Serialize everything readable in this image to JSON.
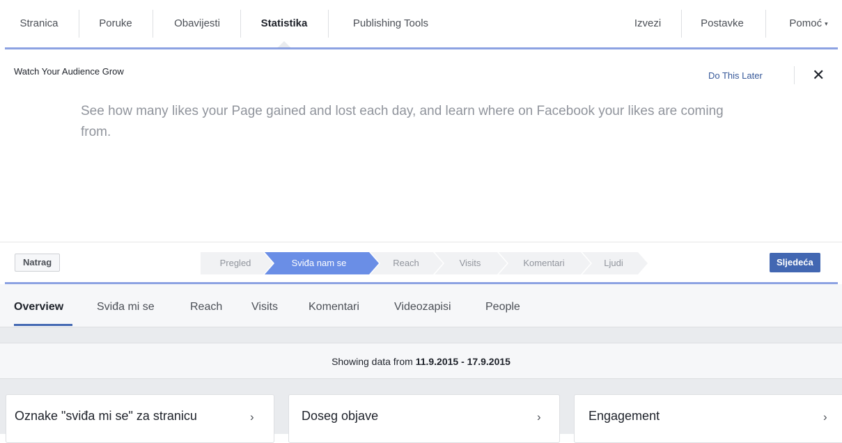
{
  "topnav": {
    "items": [
      "Stranica",
      "Poruke",
      "Obavijesti",
      "Statistika",
      "Publishing Tools"
    ],
    "right_items": [
      "Izvezi",
      "Postavke",
      "Pomoć"
    ],
    "caret": "▾"
  },
  "tour": {
    "title": "Watch Your Audience Grow",
    "later_label": "Do This Later",
    "close_glyph": "✕",
    "description": "See how many likes your Page gained and lost each day, and learn where on Facebook your likes are coming from."
  },
  "stepper": {
    "back_label": "Natrag",
    "next_label": "Sljedeća",
    "steps": [
      "Pregled",
      "Sviđa nam se",
      "Reach",
      "Visits",
      "Komentari",
      "Ljudi"
    ],
    "active_step": "Sviđa nam se"
  },
  "tabs": {
    "items": [
      "Overview",
      "Sviđa mi se",
      "Reach",
      "Visits",
      "Komentari",
      "Videozapisi",
      "People"
    ],
    "active": "Overview"
  },
  "range": {
    "prefix": "Showing data from ",
    "dates": "11.9.2015 - 17.9.2015"
  },
  "cards": {
    "items": [
      "Oznake \"sviđa mi se\" za stranicu",
      "Doseg objave",
      "Engagement"
    ],
    "chevron": "›"
  },
  "colors": {
    "accent": "#4267b2",
    "active_step": "#6a8ee6",
    "link": "#365899"
  }
}
